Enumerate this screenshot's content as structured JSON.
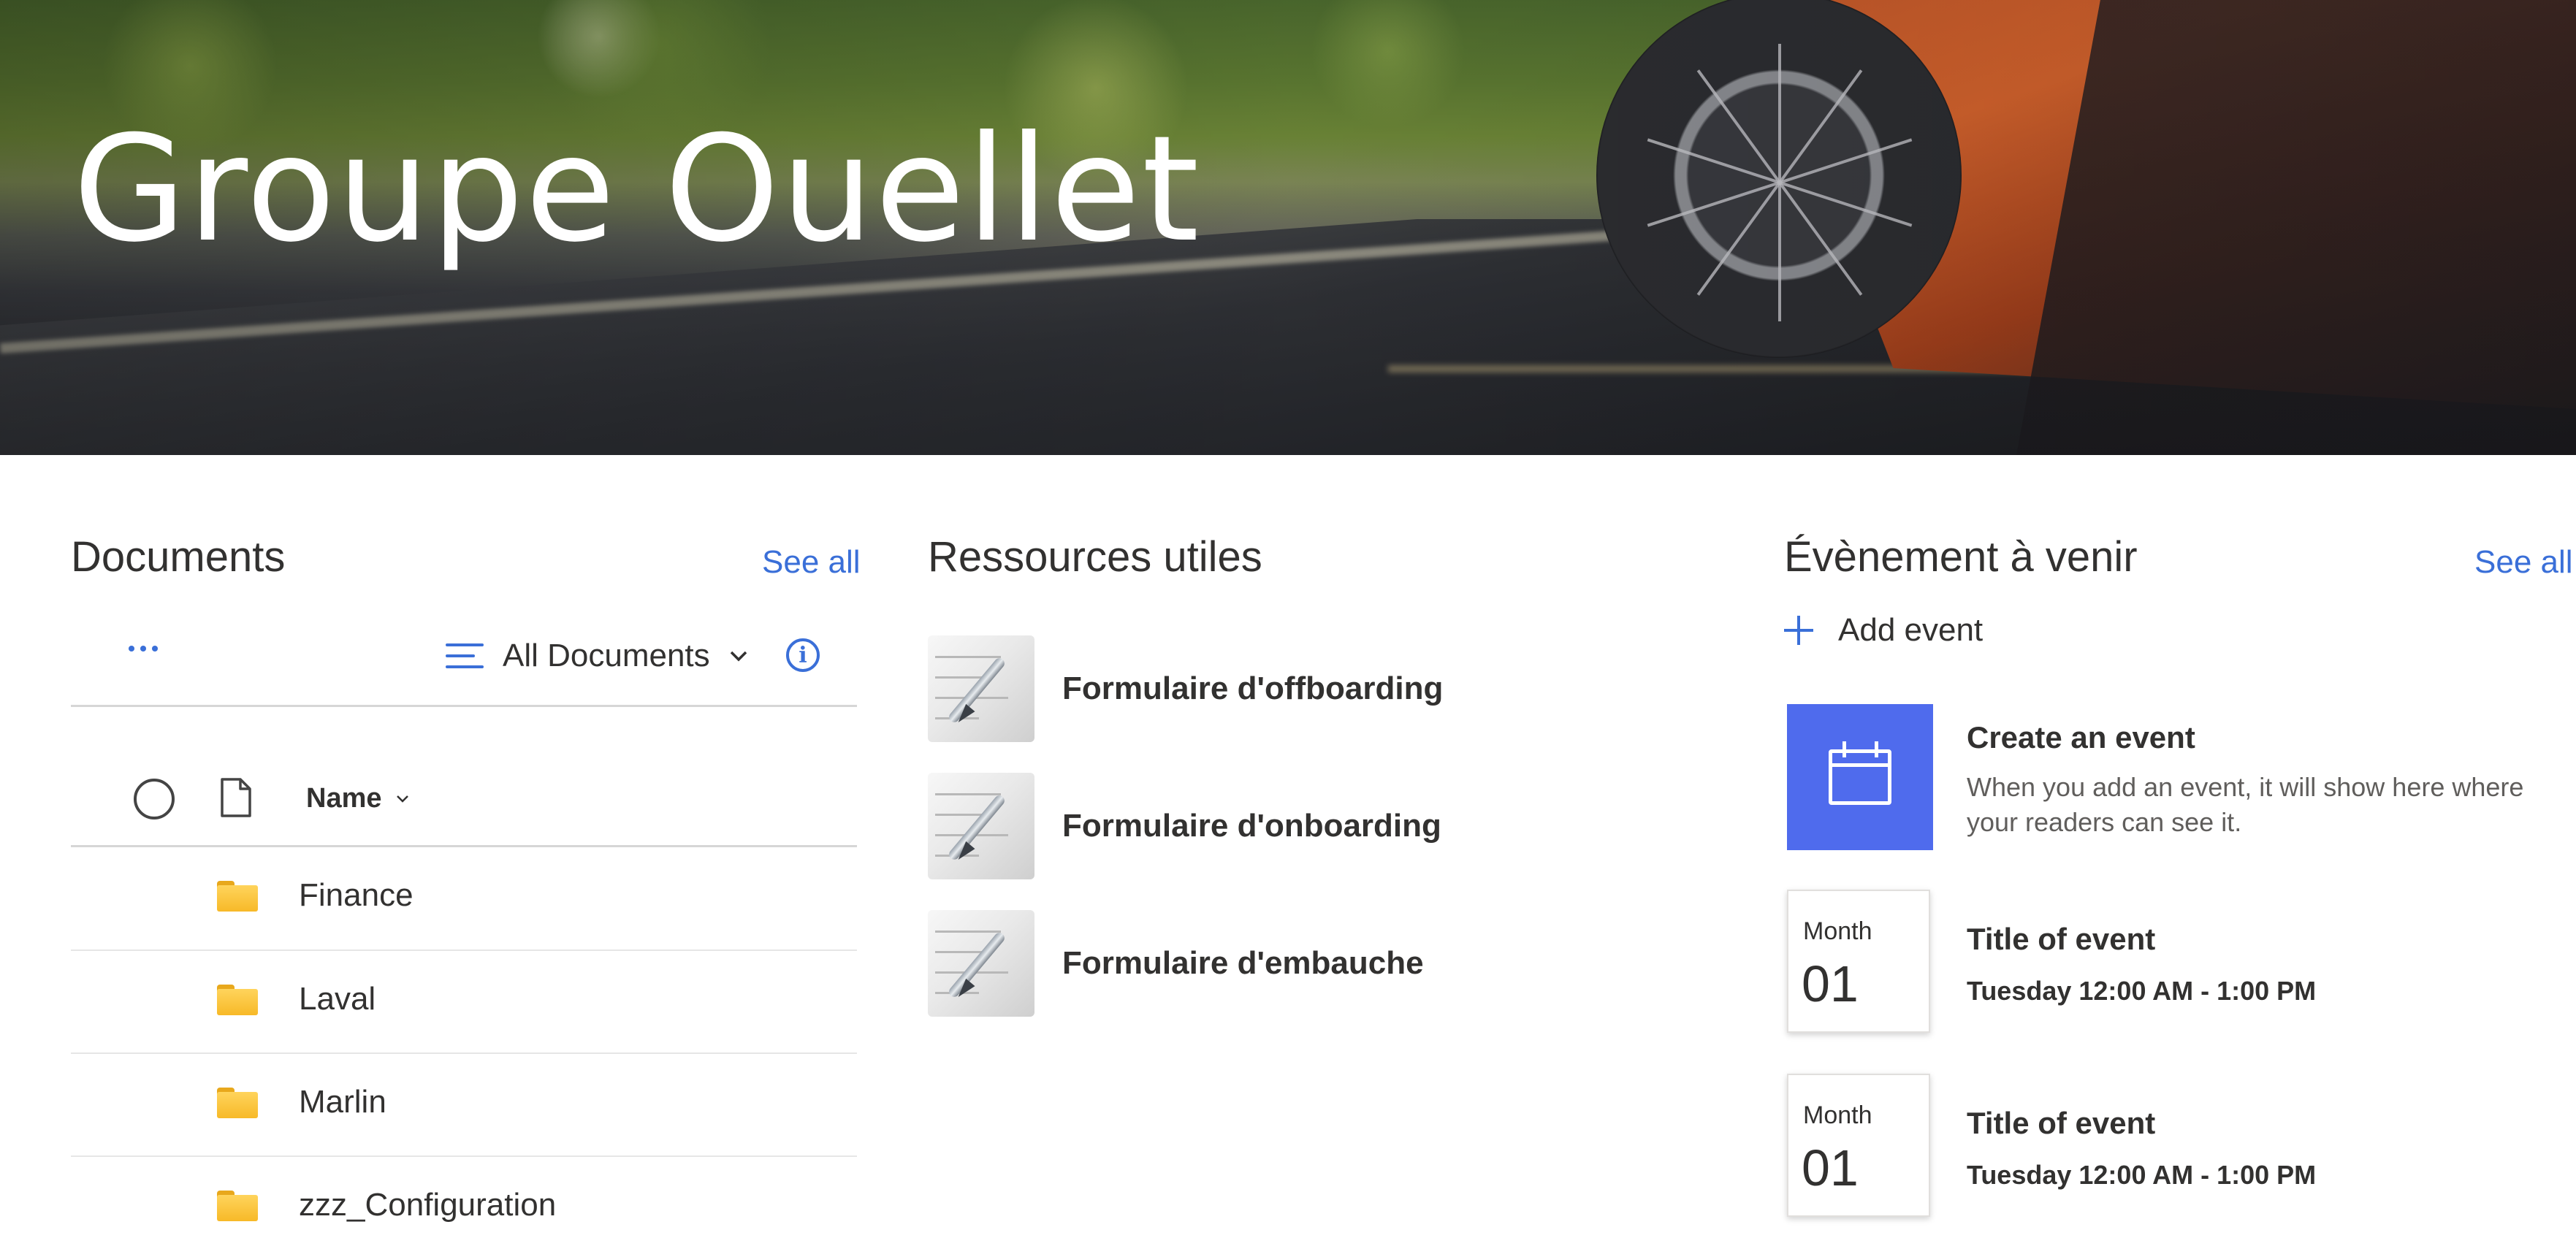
{
  "hero": {
    "title": "Groupe Ouellet"
  },
  "documents": {
    "title": "Documents",
    "see_all": "See all",
    "view_label": "All Documents",
    "column_name": "Name",
    "folders": [
      {
        "name": "Finance"
      },
      {
        "name": "Laval"
      },
      {
        "name": "Marlin"
      },
      {
        "name": "zzz_Configuration"
      }
    ]
  },
  "resources": {
    "title": "Ressources utiles",
    "items": [
      {
        "label": "Formulaire d'offboarding"
      },
      {
        "label": "Formulaire d'onboarding"
      },
      {
        "label": "Formulaire d'embauche"
      }
    ]
  },
  "events": {
    "title": "Évènement à venir",
    "see_all": "See all",
    "add_label": "Add event",
    "create": {
      "title": "Create an event",
      "description": "When you add an event, it will show here where your readers can see it."
    },
    "items": [
      {
        "month": "Month",
        "day": "01",
        "title": "Title of event",
        "time": "Tuesday 12:00 AM - 1:00 PM"
      },
      {
        "month": "Month",
        "day": "01",
        "title": "Title of event",
        "time": "Tuesday 12:00 AM - 1:00 PM"
      }
    ]
  },
  "colors": {
    "accent": "#3a6fd8",
    "event_card": "#4f6bed",
    "folder": "#f7b928"
  }
}
